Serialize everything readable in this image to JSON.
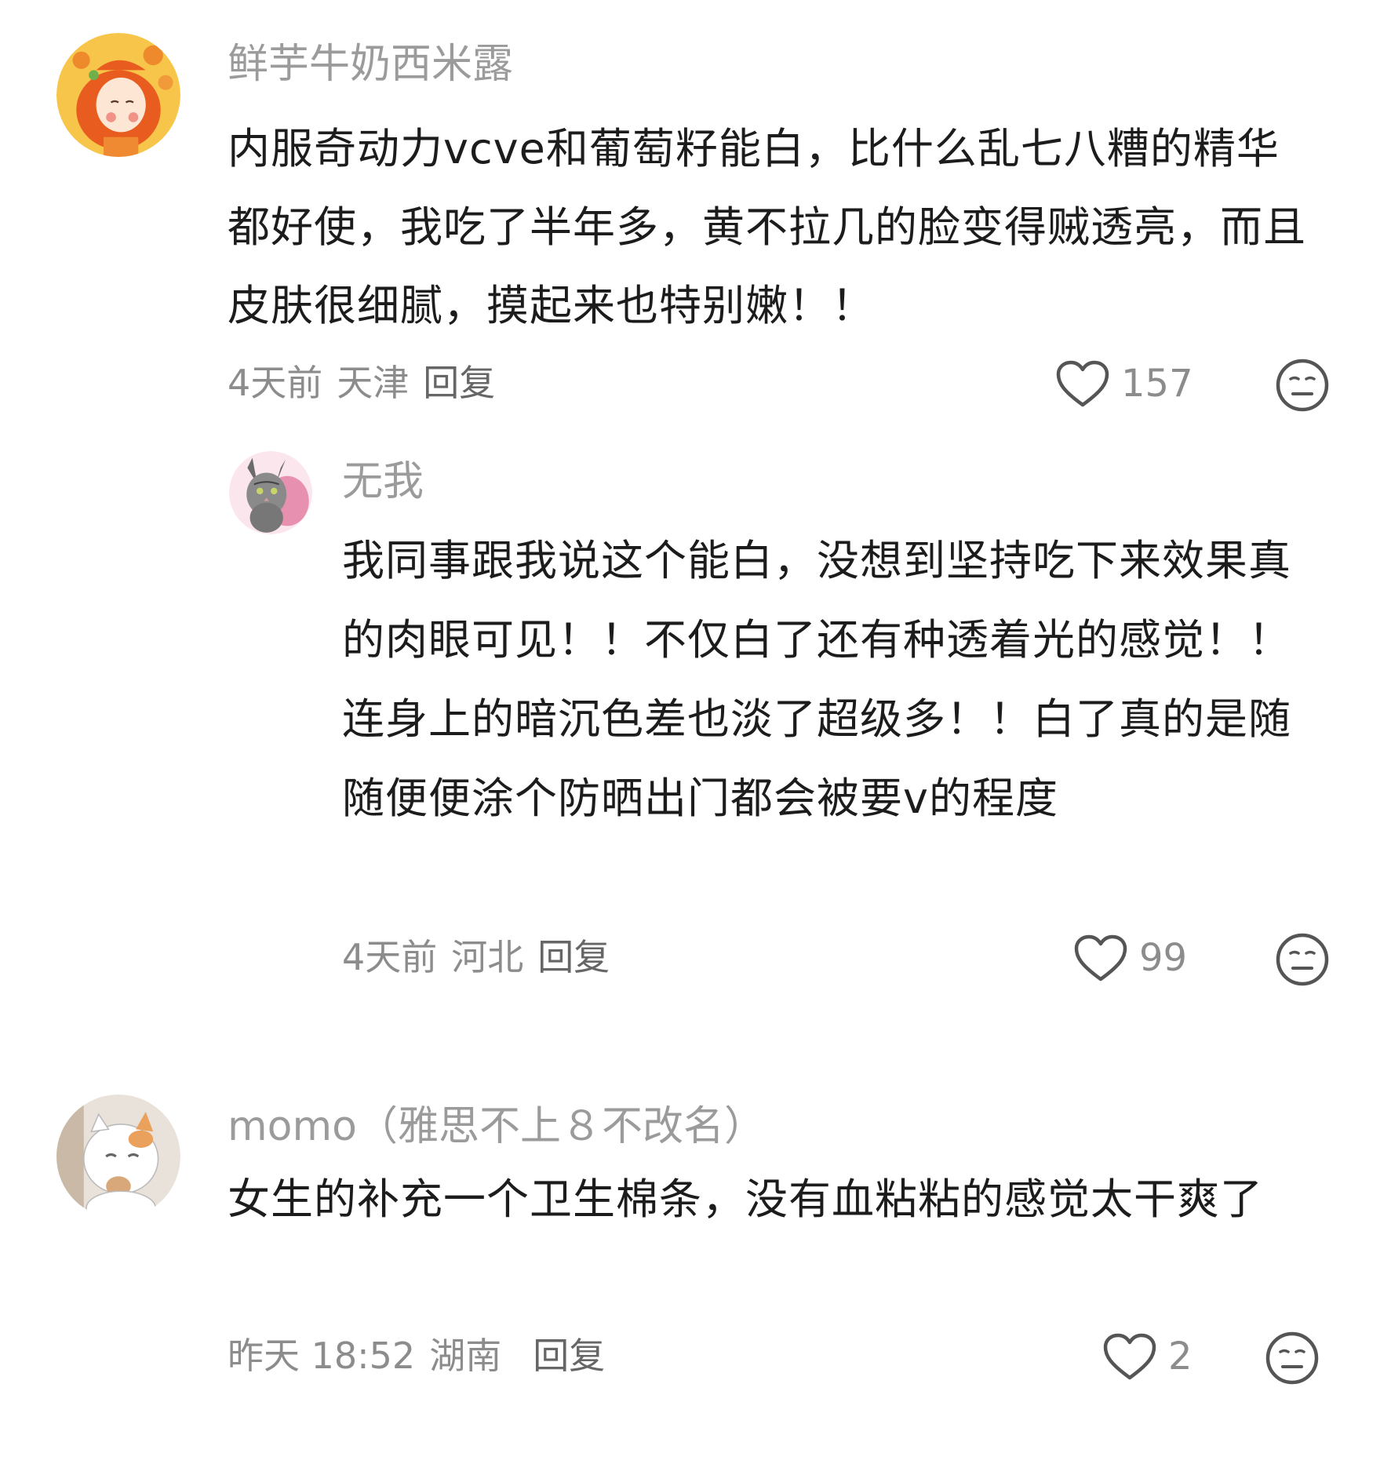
{
  "comments": [
    {
      "username": "鲜芋牛奶西米露",
      "content": "内服奇动力vcve和葡萄籽能白，比什么乱七八糟的精华都好使，我吃了半年多，黄不拉几的脸变得贼透亮，而且皮肤很细腻，摸起来也特别嫩！！",
      "time": "4天前",
      "location": "天津",
      "reply_label": "回复",
      "likes": "157",
      "avatar_icon": "orange-girl-avatar",
      "replies": [
        {
          "username": "无我",
          "content": "我同事跟我说这个能白，没想到坚持吃下来效果真的肉眼可见！！不仅白了还有种透着光的感觉！！连身上的暗沉色差也淡了超级多！！白了真的是随随便便涂个防晒出门都会被要v的程度",
          "time": "4天前",
          "location": "河北",
          "reply_label": "回复",
          "likes": "99",
          "avatar_icon": "cat-avatar"
        }
      ]
    },
    {
      "username": "momo（雅思不上８不改名）",
      "content": "女生的补充一个卫生棉条，没有血粘粘的感觉太干爽了",
      "time": "昨天 18:52",
      "location": "湖南",
      "reply_label": "回复",
      "likes": "2",
      "avatar_icon": "white-cat-avatar"
    }
  ],
  "icons": {
    "like": "heart-outline-icon",
    "react": "emoji-face-icon"
  },
  "colors": {
    "username": "#9b9b9b",
    "content": "#1c1c1c",
    "meta": "#8c8c8c",
    "background": "#ffffff"
  }
}
